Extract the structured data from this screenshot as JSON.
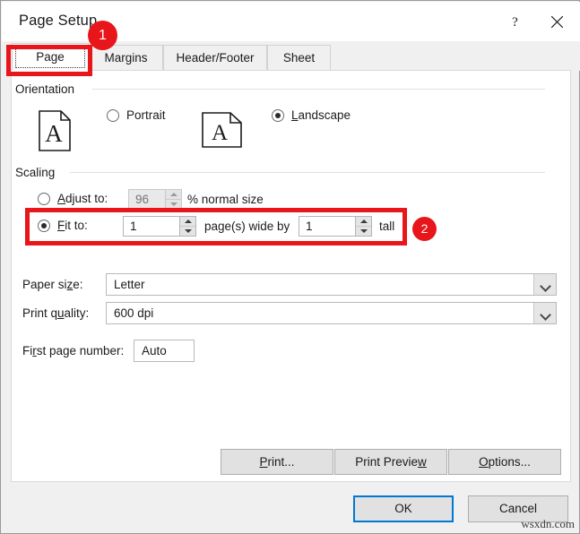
{
  "window": {
    "title": "Page Setup",
    "help_icon": "question-mark-icon",
    "close_icon": "close-icon"
  },
  "tabs": [
    {
      "label": "Page",
      "selected": true
    },
    {
      "label": "Margins",
      "selected": false
    },
    {
      "label": "Header/Footer",
      "selected": false
    },
    {
      "label": "Sheet",
      "selected": false
    }
  ],
  "orientation": {
    "group_label": "Orientation",
    "portrait": {
      "label": "Portrait",
      "checked": false,
      "icon": "portrait-page-icon"
    },
    "landscape": {
      "label": "Landscape",
      "checked": true,
      "icon": "landscape-page-icon"
    }
  },
  "scaling": {
    "group_label": "Scaling",
    "adjust_to": {
      "label": "Adjust to:",
      "checked": false,
      "value": "96",
      "suffix": "% normal size",
      "disabled": true
    },
    "fit_to": {
      "label": "Fit to:",
      "checked": true,
      "wide_value": "1",
      "middle_text": "page(s) wide by",
      "tall_value": "1",
      "suffix": "tall"
    }
  },
  "fields": {
    "paper_size": {
      "label": "Paper size:",
      "value": "Letter"
    },
    "print_quality": {
      "label": "Print quality:",
      "value": "600 dpi"
    },
    "first_page_number": {
      "label": "First page number:",
      "value": "Auto"
    }
  },
  "buttons": {
    "print": "Print...",
    "print_preview": "Print Preview",
    "options": "Options...",
    "ok": "OK",
    "cancel": "Cancel"
  },
  "annotations": {
    "badge_1": "1",
    "badge_2": "2",
    "color": "#e8151a"
  },
  "watermark": "wsxdn.com"
}
